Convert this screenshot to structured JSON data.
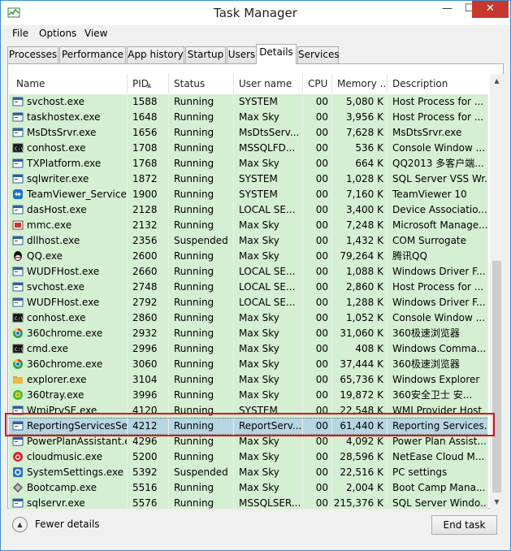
{
  "window": {
    "title": "Task Manager",
    "minimize_glyph": "—",
    "maximize_glyph": "☐",
    "close_glyph": "✕"
  },
  "menu": [
    "File",
    "Options",
    "View"
  ],
  "tabs": [
    {
      "label": "Processes",
      "active": false
    },
    {
      "label": "Performance",
      "active": false
    },
    {
      "label": "App history",
      "active": false
    },
    {
      "label": "Startup",
      "active": false
    },
    {
      "label": "Users",
      "active": false
    },
    {
      "label": "Details",
      "active": true
    },
    {
      "label": "Services",
      "active": false
    }
  ],
  "columns": {
    "name": "Name",
    "pid": "PID",
    "status": "Status",
    "user": "User name",
    "cpu": "CPU",
    "memory": "Memory ...",
    "description": "Description"
  },
  "rows": [
    {
      "icon": "window-icon",
      "name": "svchost.exe",
      "pid": "1588",
      "status": "Running",
      "user": "SYSTEM",
      "cpu": "00",
      "memory": "5,080 K",
      "description": "Host Process for ..."
    },
    {
      "icon": "window-icon",
      "name": "taskhostex.exe",
      "pid": "1648",
      "status": "Running",
      "user": "Max Sky",
      "cpu": "00",
      "memory": "3,956 K",
      "description": "Host Process for ..."
    },
    {
      "icon": "window-icon",
      "name": "MsDtsSrvr.exe",
      "pid": "1656",
      "status": "Running",
      "user": "MsDtsServ...",
      "cpu": "00",
      "memory": "7,628 K",
      "description": "MsDtsSrvr.exe"
    },
    {
      "icon": "console-icon",
      "name": "conhost.exe",
      "pid": "1708",
      "status": "Running",
      "user": "MSSQLFD...",
      "cpu": "00",
      "memory": "536 K",
      "description": "Console Window ..."
    },
    {
      "icon": "window-icon",
      "name": "TXPlatform.exe",
      "pid": "1768",
      "status": "Running",
      "user": "Max Sky",
      "cpu": "00",
      "memory": "664 K",
      "description": "QQ2013 多客户端..."
    },
    {
      "icon": "window-icon",
      "name": "sqlwriter.exe",
      "pid": "1872",
      "status": "Running",
      "user": "SYSTEM",
      "cpu": "00",
      "memory": "1,028 K",
      "description": "SQL Server VSS Wr..."
    },
    {
      "icon": "teamviewer-icon",
      "name": "TeamViewer_Service....",
      "pid": "1900",
      "status": "Running",
      "user": "SYSTEM",
      "cpu": "00",
      "memory": "7,160 K",
      "description": "TeamViewer 10"
    },
    {
      "icon": "window-icon",
      "name": "dasHost.exe",
      "pid": "2128",
      "status": "Running",
      "user": "LOCAL SE...",
      "cpu": "00",
      "memory": "3,400 K",
      "description": "Device Associatio..."
    },
    {
      "icon": "mmc-icon",
      "name": "mmc.exe",
      "pid": "2132",
      "status": "Running",
      "user": "Max Sky",
      "cpu": "00",
      "memory": "7,248 K",
      "description": "Microsoft Manage..."
    },
    {
      "icon": "window-icon",
      "name": "dllhost.exe",
      "pid": "2356",
      "status": "Suspended",
      "user": "Max Sky",
      "cpu": "00",
      "memory": "1,432 K",
      "description": "COM Surrogate"
    },
    {
      "icon": "qq-icon",
      "name": "QQ.exe",
      "pid": "2600",
      "status": "Running",
      "user": "Max Sky",
      "cpu": "00",
      "memory": "79,264 K",
      "description": "腾讯QQ"
    },
    {
      "icon": "window-icon",
      "name": "WUDFHost.exe",
      "pid": "2660",
      "status": "Running",
      "user": "LOCAL SE...",
      "cpu": "00",
      "memory": "1,088 K",
      "description": "Windows Driver F..."
    },
    {
      "icon": "window-icon",
      "name": "svchost.exe",
      "pid": "2748",
      "status": "Running",
      "user": "LOCAL SE...",
      "cpu": "00",
      "memory": "2,860 K",
      "description": "Host Process for ..."
    },
    {
      "icon": "window-icon",
      "name": "WUDFHost.exe",
      "pid": "2792",
      "status": "Running",
      "user": "LOCAL SE...",
      "cpu": "00",
      "memory": "1,288 K",
      "description": "Windows Driver F..."
    },
    {
      "icon": "console-icon",
      "name": "conhost.exe",
      "pid": "2860",
      "status": "Running",
      "user": "Max Sky",
      "cpu": "00",
      "memory": "1,052 K",
      "description": "Console Window ..."
    },
    {
      "icon": "chrome-icon",
      "name": "360chrome.exe",
      "pid": "2932",
      "status": "Running",
      "user": "Max Sky",
      "cpu": "00",
      "memory": "31,060 K",
      "description": "360极速浏览器"
    },
    {
      "icon": "console-icon",
      "name": "cmd.exe",
      "pid": "2996",
      "status": "Running",
      "user": "Max Sky",
      "cpu": "00",
      "memory": "408 K",
      "description": "Windows Comma..."
    },
    {
      "icon": "chrome-icon",
      "name": "360chrome.exe",
      "pid": "3060",
      "status": "Running",
      "user": "Max Sky",
      "cpu": "00",
      "memory": "37,444 K",
      "description": "360极速浏览器"
    },
    {
      "icon": "folder-icon",
      "name": "explorer.exe",
      "pid": "3104",
      "status": "Running",
      "user": "Max Sky",
      "cpu": "00",
      "memory": "65,736 K",
      "description": "Windows Explorer"
    },
    {
      "icon": "360-icon",
      "name": "360tray.exe",
      "pid": "3996",
      "status": "Running",
      "user": "Max Sky",
      "cpu": "00",
      "memory": "19,872 K",
      "description": "360安全卫士 安..."
    },
    {
      "icon": "window-icon",
      "name": "WmiPrvSE.exe",
      "pid": "4120",
      "status": "Running",
      "user": "SYSTEM",
      "cpu": "00",
      "memory": "22,548 K",
      "description": "WMI Provider Host"
    },
    {
      "icon": "window-icon",
      "name": "ReportingServicesSer...",
      "pid": "4212",
      "status": "Running",
      "user": "ReportServ...",
      "cpu": "00",
      "memory": "61,440 K",
      "description": "Reporting Services...",
      "selected": true
    },
    {
      "icon": "window-icon",
      "name": "PowerPlanAssistant.e...",
      "pid": "4296",
      "status": "Running",
      "user": "Max Sky",
      "cpu": "00",
      "memory": "4,092 K",
      "description": "Power Plan Assist..."
    },
    {
      "icon": "music-icon",
      "name": "cloudmusic.exe",
      "pid": "5200",
      "status": "Running",
      "user": "Max Sky",
      "cpu": "00",
      "memory": "28,596 K",
      "description": "NetEase Cloud M..."
    },
    {
      "icon": "settings-icon",
      "name": "SystemSettings.exe",
      "pid": "5392",
      "status": "Suspended",
      "user": "Max Sky",
      "cpu": "00",
      "memory": "22,516 K",
      "description": "PC settings"
    },
    {
      "icon": "bootcamp-icon",
      "name": "Bootcamp.exe",
      "pid": "5516",
      "status": "Running",
      "user": "Max Sky",
      "cpu": "00",
      "memory": "2,004 K",
      "description": "Boot Camp Mana..."
    },
    {
      "icon": "window-icon",
      "name": "sqlservr.exe",
      "pid": "5576",
      "status": "Running",
      "user": "MSSQLSER...",
      "cpu": "00",
      "memory": "215,376 K",
      "description": "SQL Server Windo..."
    }
  ],
  "footer": {
    "fewer_details": "Fewer details",
    "end_task": "End task"
  },
  "colors": {
    "row_background": "#d5efd2",
    "selected_row": "#b6d6e4",
    "highlight_box": "#e0101a",
    "close_button": "#c7372f"
  }
}
